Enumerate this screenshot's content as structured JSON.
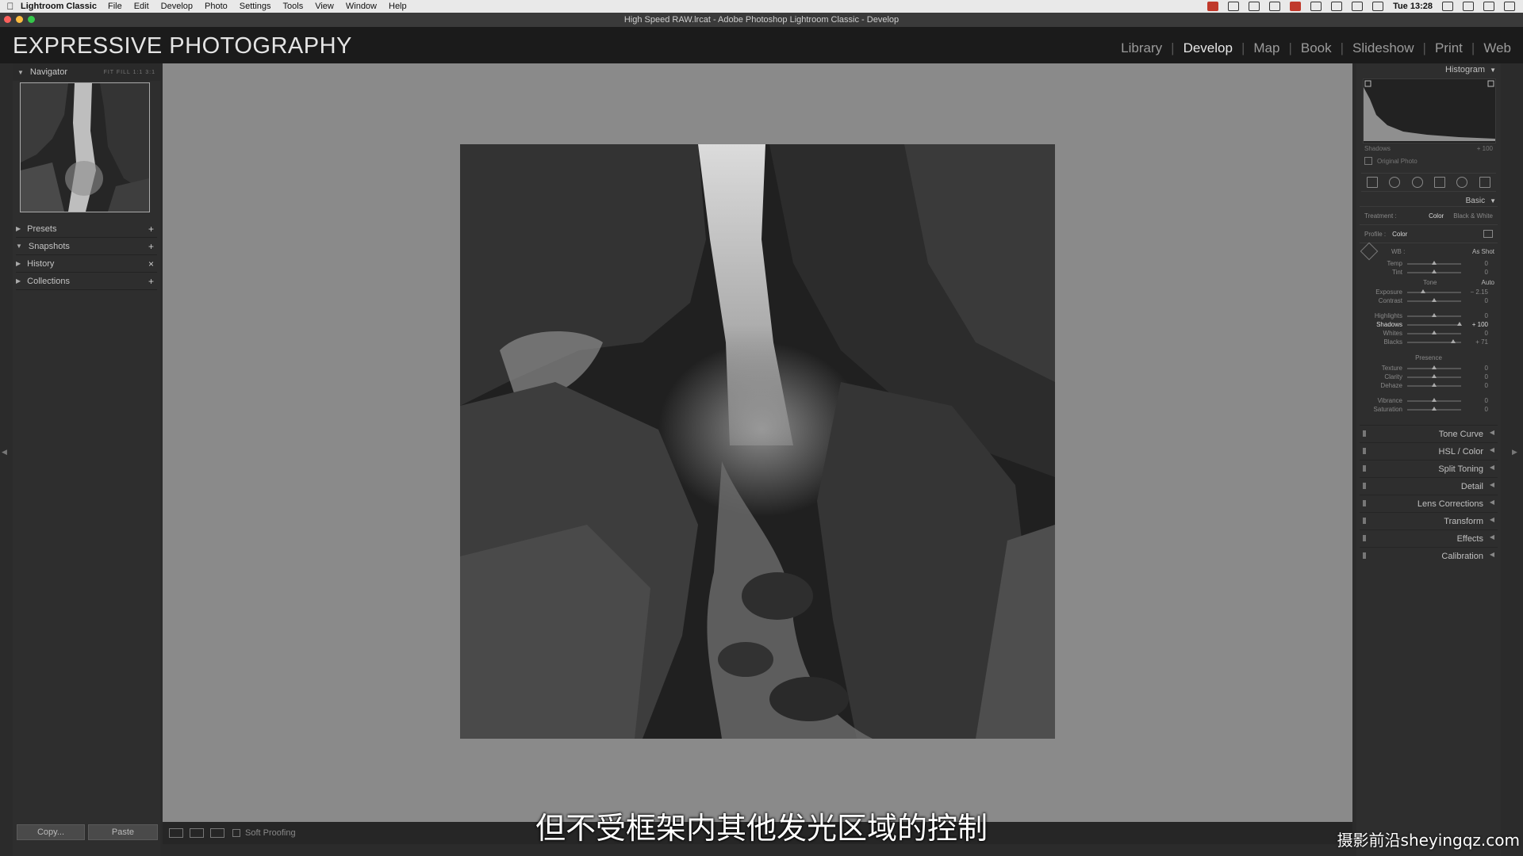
{
  "menubar": {
    "app_name": "Lightroom Classic",
    "items": [
      "File",
      "Edit",
      "Develop",
      "Photo",
      "Settings",
      "Tools",
      "View",
      "Window",
      "Help"
    ],
    "clock": "Tue 13:28"
  },
  "window": {
    "title": "High Speed RAW.lrcat - Adobe Photoshop Lightroom Classic - Develop"
  },
  "identity_plate": "EXPRESSIVE PHOTOGRAPHY",
  "modules": [
    {
      "label": "Library",
      "active": false
    },
    {
      "label": "Develop",
      "active": true
    },
    {
      "label": "Map",
      "active": false
    },
    {
      "label": "Book",
      "active": false
    },
    {
      "label": "Slideshow",
      "active": false
    },
    {
      "label": "Print",
      "active": false
    },
    {
      "label": "Web",
      "active": false
    }
  ],
  "left_panel": {
    "navigator": {
      "label": "Navigator",
      "zoom": "FIT FILL 1:1 3:1"
    },
    "sections": [
      {
        "label": "Presets",
        "action": "+"
      },
      {
        "label": "Snapshots",
        "action": "+"
      },
      {
        "label": "History",
        "action": "×"
      },
      {
        "label": "Collections",
        "action": "+"
      }
    ],
    "copy_label": "Copy...",
    "paste_label": "Paste"
  },
  "toolbar": {
    "soft_proofing_label": "Soft Proofing"
  },
  "right_panel": {
    "histogram_label": "Histogram",
    "histogram_readout": {
      "name": "Shadows",
      "value": "+ 100"
    },
    "original_photo_label": "Original Photo",
    "basic_label": "Basic",
    "treatment_label": "Treatment :",
    "treatment_color": "Color",
    "treatment_bw": "Black & White",
    "profile_label": "Profile :",
    "profile_value": "Color",
    "wb_label": "WB :",
    "wb_value": "As Shot",
    "wb_sliders": [
      {
        "label": "Temp",
        "value": "0",
        "position": 0.5
      },
      {
        "label": "Tint",
        "value": "0",
        "position": 0.5
      }
    ],
    "tone_label": "Tone",
    "auto_label": "Auto",
    "tone_sliders_a": [
      {
        "label": "Exposure",
        "value": "− 2.15",
        "position": 0.3
      },
      {
        "label": "Contrast",
        "value": "0",
        "position": 0.5
      }
    ],
    "tone_sliders_b": [
      {
        "label": "Highlights",
        "value": "0",
        "position": 0.5
      },
      {
        "label": "Shadows",
        "value": "+ 100",
        "position": 0.97
      },
      {
        "label": "Whites",
        "value": "0",
        "position": 0.5
      },
      {
        "label": "Blacks",
        "value": "+ 71",
        "position": 0.85
      }
    ],
    "presence_label": "Presence",
    "presence_sliders_a": [
      {
        "label": "Texture",
        "value": "0",
        "position": 0.5
      },
      {
        "label": "Clarity",
        "value": "0",
        "position": 0.5
      },
      {
        "label": "Dehaze",
        "value": "0",
        "position": 0.5
      }
    ],
    "presence_sliders_b": [
      {
        "label": "Vibrance",
        "value": "0",
        "position": 0.5
      },
      {
        "label": "Saturation",
        "value": "0",
        "position": 0.5
      }
    ],
    "panels": [
      "Tone Curve",
      "HSL / Color",
      "Split Toning",
      "Detail",
      "Lens Corrections",
      "Transform",
      "Effects",
      "Calibration"
    ]
  },
  "subtitle": "但不受框架内其他发光区域的控制",
  "watermark": "摄影前沿sheyingqz.com"
}
